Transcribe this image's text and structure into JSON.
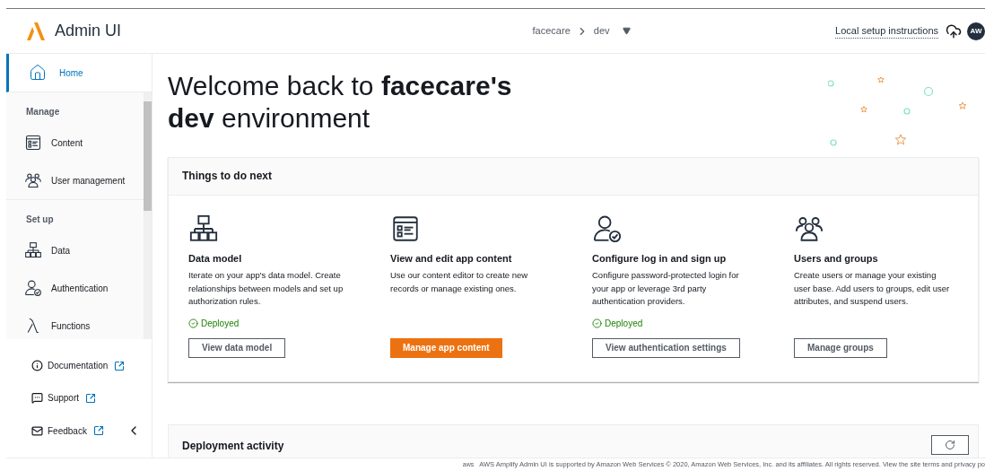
{
  "header": {
    "app_name": "Admin UI",
    "breadcrumb": [
      "facecare",
      "dev"
    ],
    "setup_link": "Local setup instructions",
    "avatar": "AW"
  },
  "sidebar": {
    "home": {
      "label": "Home",
      "selected": true
    },
    "sections": [
      {
        "title": "Manage",
        "items": [
          {
            "label": "Content",
            "kind": "content"
          },
          {
            "label": "User management",
            "kind": "users"
          }
        ]
      },
      {
        "title": "Set up",
        "items": [
          {
            "label": "Data",
            "kind": "data"
          },
          {
            "label": "Authentication",
            "kind": "auth"
          },
          {
            "label": "Functions",
            "kind": "lambda"
          }
        ]
      }
    ],
    "links": [
      {
        "label": "Documentation",
        "kind": "info"
      },
      {
        "label": "Support",
        "kind": "chat"
      },
      {
        "label": "Feedback",
        "kind": "mail"
      }
    ]
  },
  "welcome": "Welcome back to **facecare's dev** environment",
  "next": {
    "title": "Things to do next",
    "tasks": [
      {
        "kind": "data",
        "title": "Data model",
        "description": "Iterate on your app's data model. Create relationships between models and set up authorization rules.",
        "status": "Deployed",
        "button": {
          "label": "View data model",
          "kind": "secondary"
        }
      },
      {
        "kind": "content",
        "title": "View and edit app content",
        "description": "Use our content editor to create new records or manage existing ones.",
        "button": {
          "label": "Manage app content",
          "kind": "primary"
        }
      },
      {
        "kind": "auth",
        "title": "Configure log in and sign up",
        "description": "Configure password-protected login for your app or leverage 3rd party authentication providers.",
        "status": "Deployed",
        "button": {
          "label": "View authentication settings",
          "kind": "secondary"
        }
      },
      {
        "kind": "users",
        "title": "Users and groups",
        "description": "Create users or manage your existing user base. Add users to groups, edit user attributes, and suspend users.",
        "button": {
          "label": "Manage groups",
          "kind": "secondary"
        }
      }
    ]
  },
  "deployment": {
    "title": "Deployment activity"
  },
  "footer": {
    "logo": "aws",
    "text": "AWS Amplify Admin UI is supported by Amazon Web Services © 2020, Amazon Web Services, Inc. and its affiliates. All rights reserved. View the site terms and privacy po"
  }
}
